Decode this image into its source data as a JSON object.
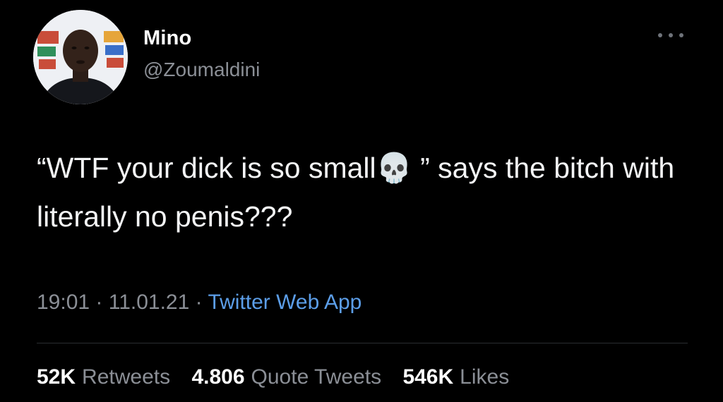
{
  "user": {
    "display_name": "Mino",
    "handle": "@Zoumaldini",
    "avatar_icon": "profile-photo"
  },
  "header": {
    "more_icon": "more-horizontal-icon"
  },
  "tweet": {
    "text_before_emoji": "“WTF your dick is so small",
    "emoji": "💀",
    "text_after_emoji": " ” says the bitch with literally no penis???"
  },
  "meta": {
    "time": "19:01",
    "separator": " · ",
    "date": "11.01.21",
    "source": "Twitter Web App"
  },
  "stats": {
    "retweets_count": "52K",
    "retweets_label": "Retweets",
    "quotes_count": "4.806",
    "quotes_label": "Quote Tweets",
    "likes_count": "546K",
    "likes_label": "Likes"
  },
  "colors": {
    "background": "#000000",
    "text": "#f4f5f6",
    "secondary": "#8b8f96",
    "link": "#5c9ee8",
    "divider": "#2a2d31"
  }
}
